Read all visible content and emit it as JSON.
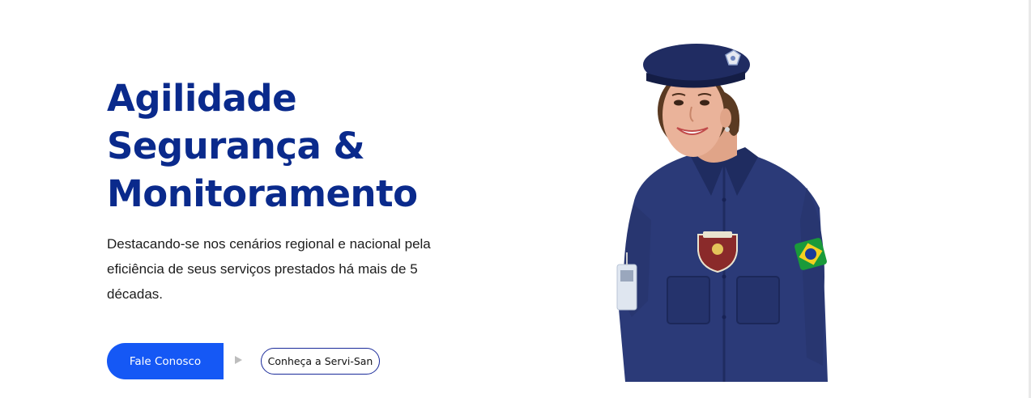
{
  "hero": {
    "title_line1": "Agilidade",
    "title_line2": "Segurança &",
    "title_line3": "Monitoramento",
    "description": "Destacando-se nos cenários regional e nacional pela eficiência de seus serviços prestados há mais de 5 décadas."
  },
  "buttons": {
    "primary_label": "Fale Conosco",
    "secondary_label": "Conheça a Servi-San"
  },
  "image": {
    "alt": "Vigilante uniformizada da Servi-San"
  },
  "colors": {
    "title": "#0a2a8c",
    "primary_button": "#1558f5",
    "uniform": "#2b3a78"
  }
}
